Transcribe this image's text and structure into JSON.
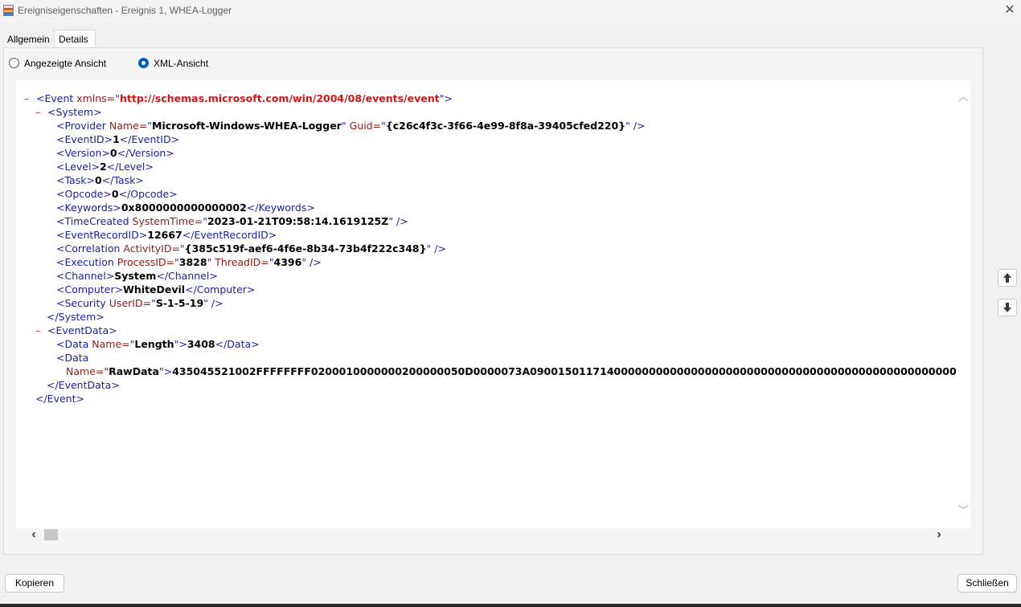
{
  "window": {
    "title": "Ereigniseigenschaften - Ereignis 1, WHEA-Logger",
    "close_glyph": "✕",
    "app_icon": "event-viewer-icon"
  },
  "tabs": [
    {
      "label": "Allgemein",
      "active": false
    },
    {
      "label": "Details",
      "active": true
    }
  ],
  "view_options": [
    {
      "label": "Angezeigte Ansicht",
      "selected": false
    },
    {
      "label": "XML-Ansicht",
      "selected": true
    }
  ],
  "xml": {
    "collapse_glyph": "–",
    "event_open": "<Event",
    "xmlns_attr": " xmlns=",
    "xmlns_value": "http://schemas.microsoft.com/win/2004/08/events/event",
    "system_open": "<System>",
    "provider": {
      "tag": "<Provider",
      "name_attr": " Name=",
      "name": "Microsoft-Windows-WHEA-Logger",
      "guid_attr": " Guid=",
      "guid": "{c26c4f3c-3f66-4e99-8f8a-39405cfed220}"
    },
    "event_id": {
      "open": "<EventID>",
      "value": "1",
      "close": "</EventID>"
    },
    "version": {
      "open": "<Version>",
      "value": "0",
      "close": "</Version>"
    },
    "level": {
      "open": "<Level>",
      "value": "2",
      "close": "</Level>"
    },
    "task": {
      "open": "<Task>",
      "value": "0",
      "close": "</Task>"
    },
    "opcode": {
      "open": "<Opcode>",
      "value": "0",
      "close": "</Opcode>"
    },
    "keywords": {
      "open": "<Keywords>",
      "value": "0x8000000000000002",
      "close": "</Keywords>"
    },
    "time_created": {
      "tag": "<TimeCreated",
      "attr": " SystemTime=",
      "value": "2023-01-21T09:58:14.1619125Z"
    },
    "event_record_id": {
      "open": "<EventRecordID>",
      "value": "12667",
      "close": "</EventRecordID>"
    },
    "correlation": {
      "tag": "<Correlation",
      "attr": " ActivityID=",
      "value": "{385c519f-aef6-4f6e-8b34-73b4f222c348}"
    },
    "execution": {
      "tag": "<Execution",
      "attr1": " ProcessID=",
      "value1": "3828",
      "attr2": " ThreadID=",
      "value2": "4396"
    },
    "channel": {
      "open": "<Channel>",
      "value": "System",
      "close": "</Channel>"
    },
    "computer": {
      "open": "<Computer>",
      "value": "WhiteDevil",
      "close": "</Computer>"
    },
    "security": {
      "tag": "<Security",
      "attr": " UserID=",
      "value": "S-1-5-19"
    },
    "system_close": "</System>",
    "eventdata_open": "<EventData>",
    "data_length": {
      "tag": "<Data",
      "attr": " Name=",
      "name": "Length",
      "value": "3408",
      "close": "</Data>"
    },
    "data_raw": {
      "tag": "<Data",
      "attr": "Name=",
      "name": "RawData",
      "value": "435045521002FFFFFFFF0200010000000200000050D0000073A0900150117140000000000000000000000000000000000000000000000000000000"
    },
    "eventdata_close": "</EventData>",
    "event_close": "</Event>",
    "quote": "\"",
    "tag_end": ">",
    "self_close": " />"
  },
  "scrollbar": {
    "up_glyph": "︿",
    "down_glyph": "﹀",
    "left_glyph": "‹",
    "right_glyph": "›"
  },
  "side_buttons": [
    {
      "icon": "arrow-up-icon"
    },
    {
      "icon": "arrow-down-icon"
    }
  ],
  "buttons": {
    "copy": "Kopieren",
    "close": "Schließen"
  }
}
